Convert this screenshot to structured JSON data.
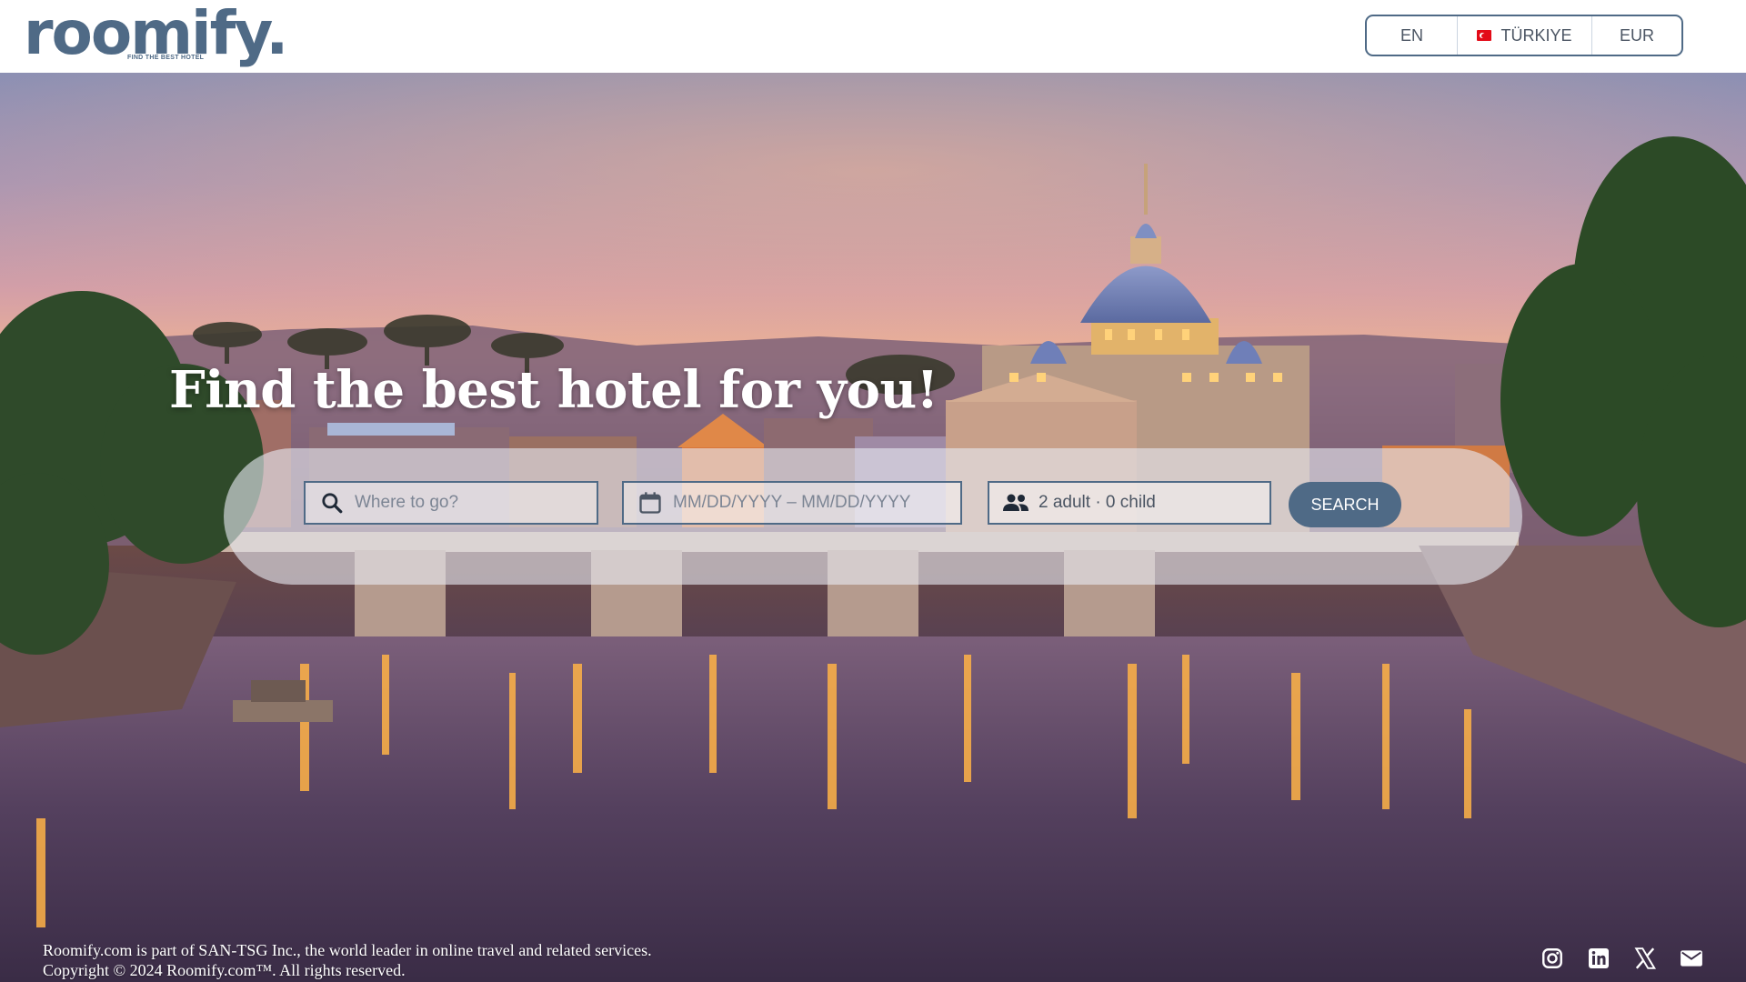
{
  "header": {
    "logo": {
      "wordmark": "roomify.",
      "tagline": "FIND THE BEST HOTEL"
    },
    "language": "EN",
    "country": {
      "flag_icon": "turkey-flag-icon",
      "label": "TÜRKIYE"
    },
    "currency": "EUR"
  },
  "hero": {
    "title": "Find the best hotel for you!",
    "background": "rome-st-peters-basilica-sunset"
  },
  "search": {
    "destination": {
      "icon": "search-icon",
      "placeholder": "Where to go?"
    },
    "dates": {
      "icon": "calendar-icon",
      "placeholder": "MM/DD/YYYY – MM/DD/YYYY"
    },
    "guests": {
      "icon": "people-icon",
      "value": "2 adult · 0 child"
    },
    "button_label": "SEARCH"
  },
  "footer": {
    "line1": "Roomify.com is part of SAN-TSG Inc., the world leader in online travel and related services.",
    "line2": "Copyright © 2024 Roomify.com™. All rights reserved.",
    "socials": [
      "instagram-icon",
      "linkedin-icon",
      "x-icon",
      "mail-icon"
    ]
  },
  "colors": {
    "brand": "#4f6a86",
    "header_bg": "#ffffff",
    "button_text": "#ffffff"
  }
}
